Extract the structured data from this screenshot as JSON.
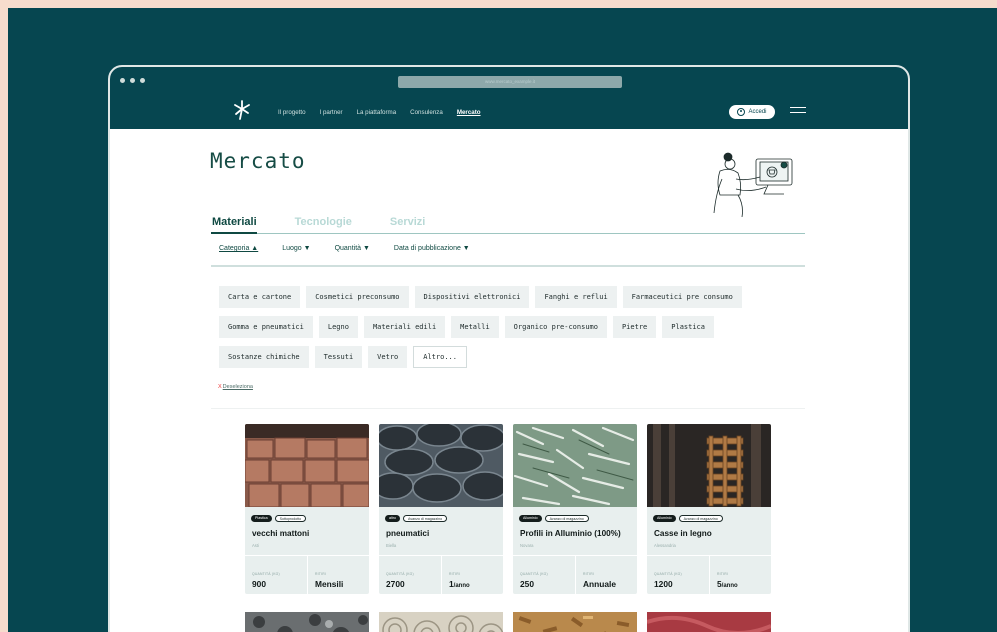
{
  "browser": {
    "url": "www.mercato_example.it"
  },
  "nav": {
    "items": [
      "Il progetto",
      "I partner",
      "La piattaforma",
      "Consulenza",
      "Mercato"
    ],
    "active": "Mercato",
    "login_label": "Accedi"
  },
  "page": {
    "title": "Mercato"
  },
  "tabs": [
    "Materiali",
    "Tecnologie",
    "Servizi"
  ],
  "filters": [
    "Categoria ▲",
    "Luogo ▼",
    "Quantità ▼",
    "Data di pubblicazione ▼"
  ],
  "categories": {
    "row1": [
      "Carta e cartone",
      "Cosmetici preconsumo",
      "Dispositivi elettronici",
      "Fanghi e reflui",
      "Farmaceutici pre consumo"
    ],
    "row2": [
      "Gomma e pneumatici",
      "Legno",
      "Materiali edili",
      "Metalli",
      "Organico pre-consumo",
      "Pietre",
      "Plastica"
    ],
    "row3": [
      "Sostanze chimiche",
      "Tessuti",
      "Vetro"
    ],
    "more": "Altro..."
  },
  "deselect": {
    "x": "X",
    "label": "Deseleziona"
  },
  "cards": [
    {
      "tag1": "Plastica",
      "tag2": "Sottoprodotto",
      "name": "vecchi mattoni",
      "location": "Asti",
      "qty_label": "QUANTITÀ (KG)",
      "qty": "900",
      "rit_label": "RITIRI",
      "rit": "Mensili",
      "rit_unit": ""
    },
    {
      "tag1": "altro",
      "tag2": "Avanzo di magazzino",
      "name": "pneumatici",
      "location": "Biella",
      "qty_label": "QUANTITÀ (KG)",
      "qty": "2700",
      "rit_label": "RITIRI",
      "rit": "1",
      "rit_unit": "/anno"
    },
    {
      "tag1": "Alluminio",
      "tag2": "Avanzo di magazzino",
      "name": "Profili in Alluminio (100%)",
      "location": "Novara",
      "qty_label": "QUANTITÀ (KG)",
      "qty": "250",
      "rit_label": "RITIRI",
      "rit": "Annuale",
      "rit_unit": ""
    },
    {
      "tag1": "Alluminio",
      "tag2": "Avanzo di magazzino",
      "name": "Casse in legno",
      "location": "Alessandria",
      "qty_label": "QUANTITÀ (KG)",
      "qty": "1200",
      "rit_label": "RITIRI",
      "rit": "5",
      "rit_unit": "/anno"
    }
  ],
  "colors": {
    "brand": "#064650",
    "accent_text": "#0f4942",
    "page_bg": "#f6dccd",
    "card_bg": "#e8efee"
  }
}
